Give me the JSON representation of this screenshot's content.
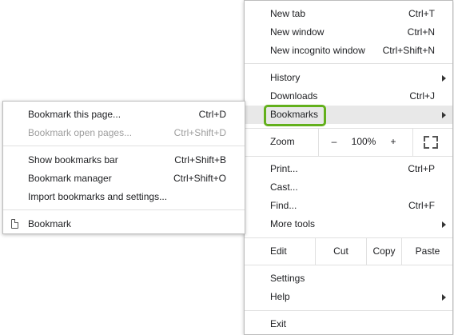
{
  "main_menu": {
    "new_tab": {
      "label": "New tab",
      "shortcut": "Ctrl+T"
    },
    "new_window": {
      "label": "New window",
      "shortcut": "Ctrl+N"
    },
    "new_incognito": {
      "label": "New incognito window",
      "shortcut": "Ctrl+Shift+N"
    },
    "history": {
      "label": "History"
    },
    "downloads": {
      "label": "Downloads",
      "shortcut": "Ctrl+J"
    },
    "bookmarks": {
      "label": "Bookmarks"
    },
    "zoom": {
      "label": "Zoom",
      "minus": "–",
      "level": "100%",
      "plus": "+",
      "fullscreen_icon": "fullscreen-icon"
    },
    "print": {
      "label": "Print...",
      "shortcut": "Ctrl+P"
    },
    "cast": {
      "label": "Cast..."
    },
    "find": {
      "label": "Find...",
      "shortcut": "Ctrl+F"
    },
    "more_tools": {
      "label": "More tools"
    },
    "edit": {
      "label": "Edit",
      "cut": "Cut",
      "copy": "Copy",
      "paste": "Paste"
    },
    "settings": {
      "label": "Settings"
    },
    "help": {
      "label": "Help"
    },
    "exit": {
      "label": "Exit"
    }
  },
  "bookmarks_menu": {
    "bookmark_page": {
      "label": "Bookmark this page...",
      "shortcut": "Ctrl+D"
    },
    "bookmark_open_pages": {
      "label": "Bookmark open pages...",
      "shortcut": "Ctrl+Shift+D"
    },
    "show_bar": {
      "label": "Show bookmarks bar",
      "shortcut": "Ctrl+Shift+B"
    },
    "manager": {
      "label": "Bookmark manager",
      "shortcut": "Ctrl+Shift+O"
    },
    "import": {
      "label": "Import bookmarks and settings..."
    },
    "bookmark_item": {
      "label": "Bookmark",
      "icon": "page-icon"
    }
  },
  "colors": {
    "highlight": "#63b01c",
    "hover": "#e8e8e8"
  }
}
